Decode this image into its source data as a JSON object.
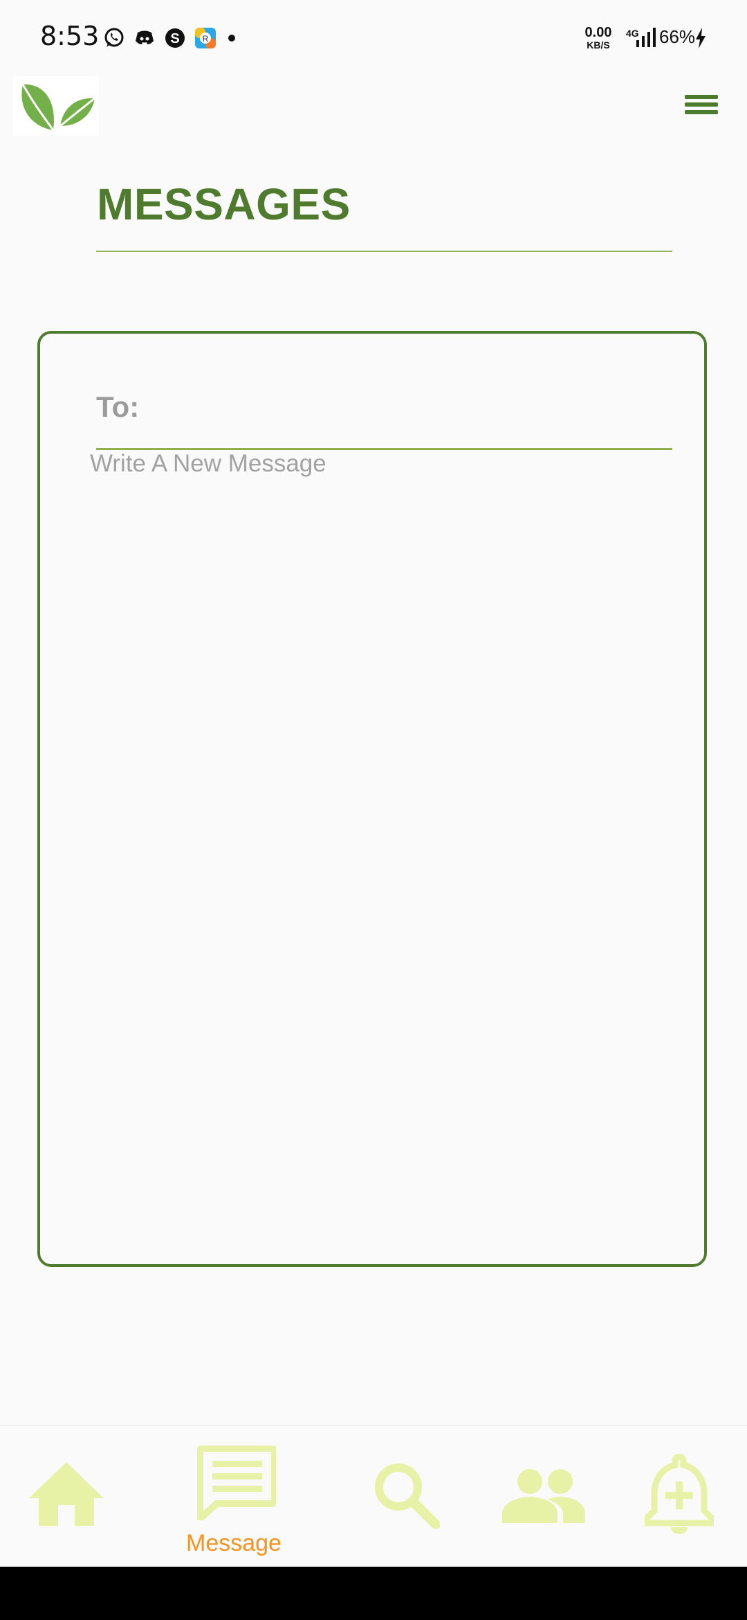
{
  "status_bar": {
    "time": "8:53",
    "speed_value": "0.00",
    "speed_unit": "KB/S",
    "network": "4G",
    "battery": "66%",
    "notification_icons": [
      "whatsapp-icon",
      "discord-icon",
      "skype-icon",
      "app-icon",
      "dot-icon"
    ]
  },
  "app_bar": {
    "logo": "leaf-logo",
    "menu_icon": "hamburger-menu-icon"
  },
  "page": {
    "title": "MESSAGES"
  },
  "compose": {
    "to_label": "To:",
    "to_value": "",
    "message_placeholder": "Write A New Message",
    "message_value": ""
  },
  "bottom_nav": {
    "items": [
      {
        "icon": "home-icon",
        "label": "",
        "active": false
      },
      {
        "icon": "message-icon",
        "label": "Message",
        "active": true
      },
      {
        "icon": "search-icon",
        "label": "",
        "active": false
      },
      {
        "icon": "people-icon",
        "label": "",
        "active": false
      },
      {
        "icon": "bell-plus-icon",
        "label": "",
        "active": false
      }
    ]
  },
  "colors": {
    "primary_green": "#4e7b2d",
    "rule_green": "#8fb04f",
    "nav_icon": "#e8f2a6",
    "active_label": "#f39322",
    "background": "#fafafa"
  }
}
